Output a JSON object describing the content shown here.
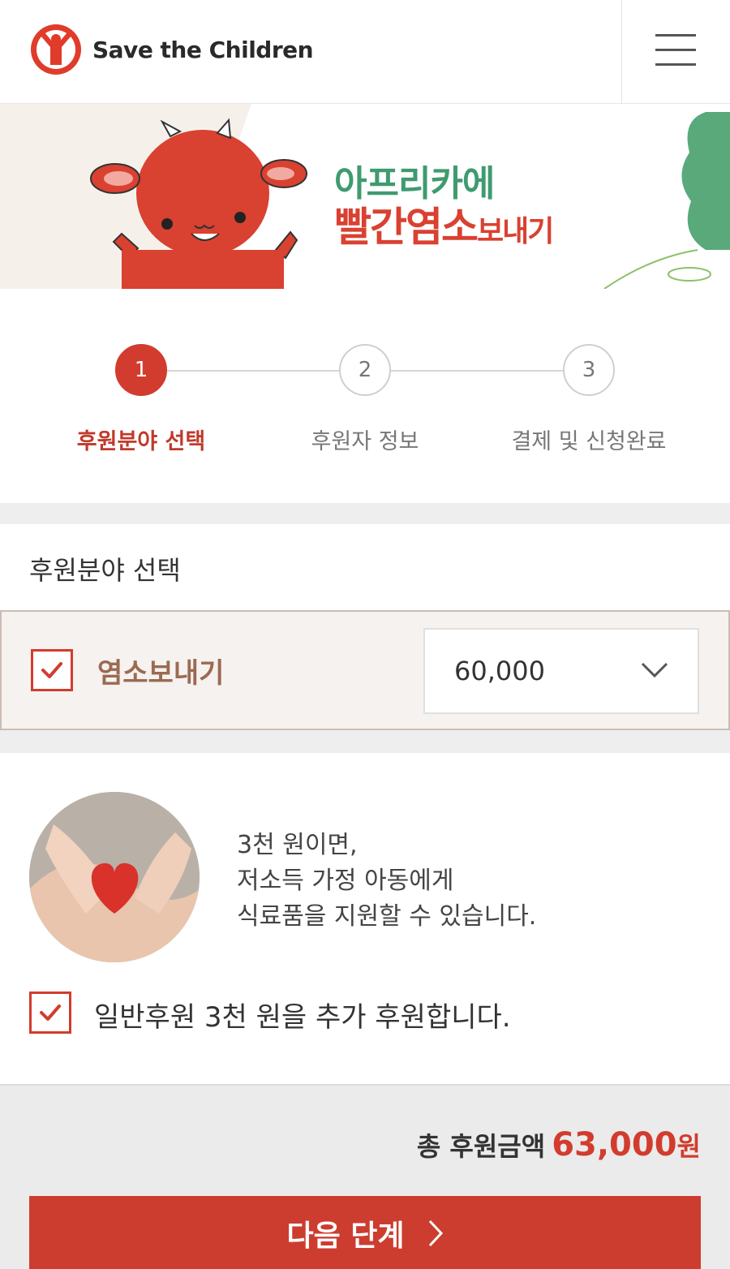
{
  "header": {
    "brand_name": "Save the Children",
    "menu_icon": "hamburger-menu-icon"
  },
  "banner": {
    "line1": "아프리카에",
    "line2_big": "빨간염소",
    "line2_small": "보내기"
  },
  "steps": [
    {
      "number": "1",
      "label": "후원분야 선택",
      "active": true
    },
    {
      "number": "2",
      "label": "후원자 정보",
      "active": false
    },
    {
      "number": "3",
      "label": "결제 및 신청완료",
      "active": false
    }
  ],
  "section": {
    "title": "후원분야 선택",
    "item_label": "염소보내기",
    "item_checked": true,
    "amount": "60,000"
  },
  "extra": {
    "lines": [
      "3천 원이면,",
      "저소득 가정 아동에게",
      "식료품을 지원할 수 있습니다."
    ],
    "check_label": "일반후원 3천 원을 추가 후원합니다.",
    "checked": true
  },
  "total": {
    "label": "총 후원금액",
    "value": "63,000",
    "unit": "원"
  },
  "next_button": {
    "label": "다음 단계"
  },
  "colors": {
    "accent": "#d23c2e",
    "green": "#3f9b6f",
    "item_brown": "#9b6a52"
  }
}
